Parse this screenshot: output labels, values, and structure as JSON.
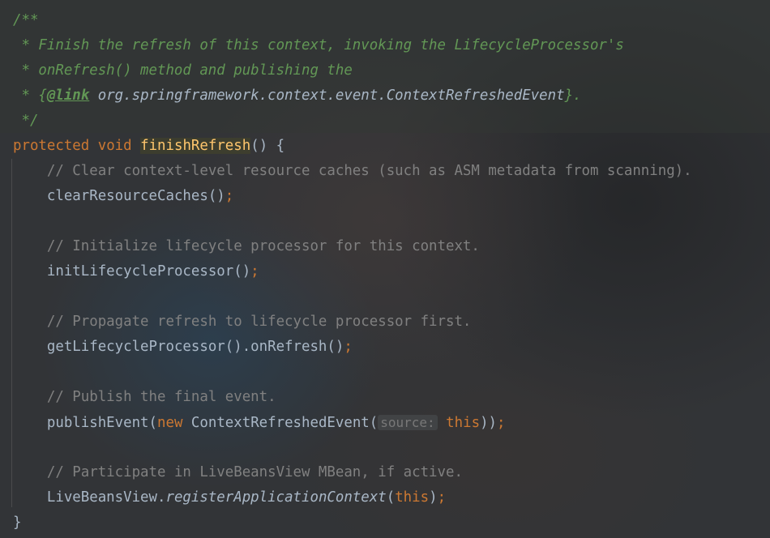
{
  "doc": {
    "open": "/**",
    "line1": " * Finish the refresh of this context, invoking the LifecycleProcessor's",
    "line2": " * onRefresh() method and publishing the",
    "line3_prefix": " * {",
    "line3_tag": "@link",
    "line3_ref": " org.springframework.context.event.ContextRefreshedEvent",
    "line3_suffix": "}.",
    "close": " */"
  },
  "signature": {
    "modifier": "protected",
    "return_type": "void",
    "name": "finishRefresh",
    "rest": "() {"
  },
  "body": {
    "comment1": "// Clear context-level resource caches (such as ASM metadata from scanning).",
    "call1": "clearResourceCaches()",
    "comment2": "// Initialize lifecycle processor for this context.",
    "call2": "initLifecycleProcessor()",
    "comment3": "// Propagate refresh to lifecycle processor first.",
    "call3": "getLifecycleProcessor().onRefresh()",
    "comment4": "// Publish the final event.",
    "call4_fn": "publishEvent(",
    "call4_new": "new",
    "call4_class": " ContextRefreshedEvent(",
    "call4_hint": "source:",
    "call4_this": "this",
    "call4_close": "))",
    "comment5": "// Participate in LiveBeansView MBean, if active.",
    "call5_class": "LiveBeansView.",
    "call5_method": "registerApplicationContext",
    "call5_open": "(",
    "call5_this": "this",
    "call5_close": ")",
    "semicolon": ";",
    "closing_brace": "}"
  },
  "colors": {
    "background": "#323437",
    "default_text": "#a9b7c6",
    "keyword": "#cc7832",
    "doc_comment": "#629755",
    "comment": "#808080",
    "method_declaration": "#ffc66d"
  }
}
